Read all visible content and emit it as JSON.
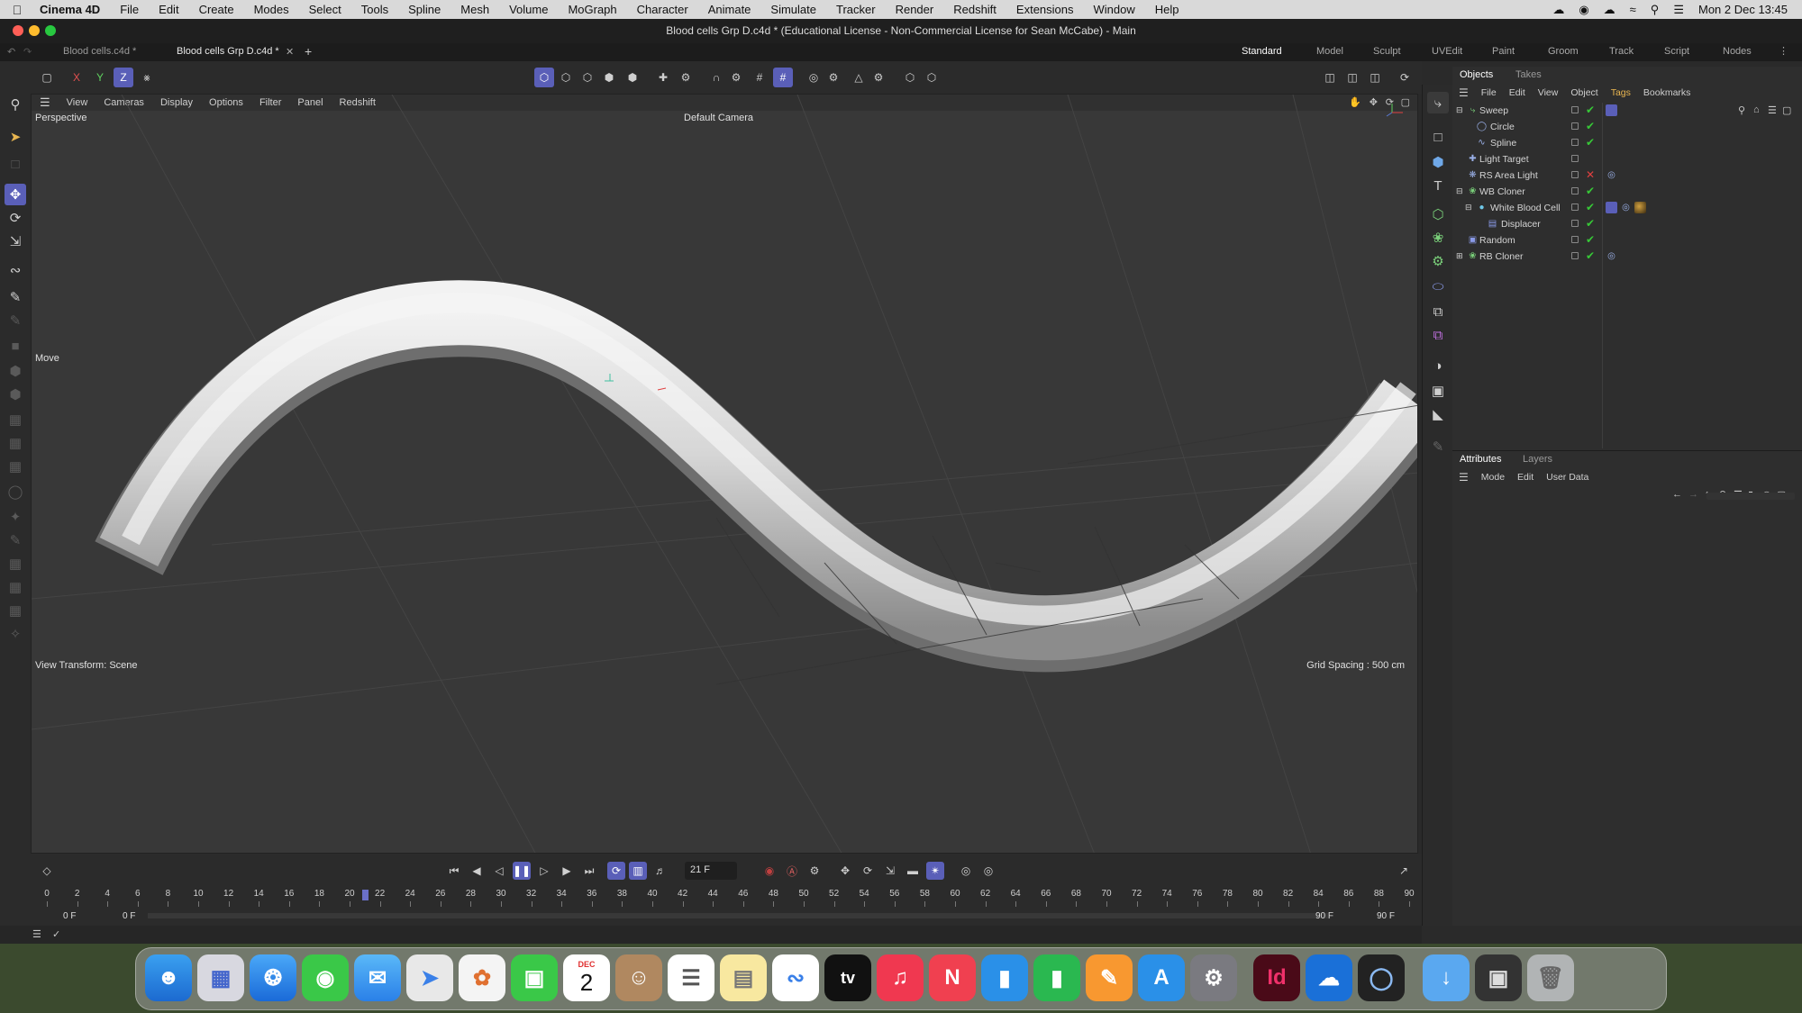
{
  "menubar": {
    "app_name": "Cinema 4D",
    "items": [
      "File",
      "Edit",
      "Create",
      "Modes",
      "Select",
      "Tools",
      "Spline",
      "Mesh",
      "Volume",
      "MoGraph",
      "Character",
      "Animate",
      "Simulate",
      "Tracker",
      "Render",
      "Redshift",
      "Extensions",
      "Window",
      "Help"
    ],
    "clock": "Mon 2 Dec  13:45"
  },
  "window": {
    "title": "Blood cells Grp D.c4d * (Educational License - Non-Commercial License for Sean McCabe) - Main",
    "doc_tabs": [
      "Blood cells.c4d *",
      "Blood cells Grp D.c4d *"
    ],
    "active_tab": "Blood cells Grp D.c4d *",
    "layouts": [
      "Standard",
      "Model",
      "Sculpt",
      "UVEdit",
      "Paint",
      "Groom",
      "Track",
      "Script",
      "Nodes"
    ],
    "active_layout": "Standard"
  },
  "toolbar": {
    "axis_x": "X",
    "axis_y": "Y",
    "axis_z": "Z"
  },
  "viewport": {
    "menu": [
      "View",
      "Cameras",
      "Display",
      "Options",
      "Filter",
      "Panel",
      "Redshift"
    ],
    "projection": "Perspective",
    "camera": "Default Camera",
    "tool_label": "Move",
    "view_transform": "View Transform: Scene",
    "grid_spacing": "Grid Spacing : 500 cm"
  },
  "objects": {
    "tabs": [
      "Objects",
      "Takes"
    ],
    "menu": [
      "File",
      "Edit",
      "View",
      "Object",
      "Tags",
      "Bookmarks"
    ],
    "active_menu": "Tags",
    "rows": [
      {
        "name": "Sweep",
        "level": 0,
        "expander": "-",
        "icon": "sweep-icon",
        "status": "check"
      },
      {
        "name": "Circle",
        "level": 1,
        "expander": "",
        "icon": "circle-icon",
        "status": "check"
      },
      {
        "name": "Spline",
        "level": 1,
        "expander": "",
        "icon": "spline-icon",
        "status": "check"
      },
      {
        "name": "Light Target",
        "level": 0,
        "expander": "",
        "icon": "light-target-icon",
        "status": ""
      },
      {
        "name": "RS Area Light",
        "level": 0,
        "expander": "",
        "icon": "light-icon",
        "status": "x"
      },
      {
        "name": "WB Cloner",
        "level": 0,
        "expander": "-",
        "icon": "cloner-icon",
        "status": "check"
      },
      {
        "name": "White Blood Cell",
        "level": 1,
        "expander": "-",
        "icon": "sphere-icon",
        "status": "check"
      },
      {
        "name": "Displacer",
        "level": 2,
        "expander": "",
        "icon": "displacer-icon",
        "status": "check"
      },
      {
        "name": "Random",
        "level": 0,
        "expander": "",
        "icon": "random-icon",
        "status": "check"
      },
      {
        "name": "RB Cloner",
        "level": 0,
        "expander": "+",
        "icon": "cloner-icon",
        "status": "check"
      }
    ]
  },
  "attributes": {
    "tabs": [
      "Attributes",
      "Layers"
    ],
    "menu": [
      "Mode",
      "Edit",
      "User Data"
    ]
  },
  "timeline": {
    "current_frame": "21 F",
    "current_frame_value": 21,
    "start_frame": "0 F",
    "preview_start": "0 F",
    "end_frame": "90 F",
    "preview_end": "90 F",
    "ticks": [
      "0",
      "2",
      "4",
      "6",
      "8",
      "10",
      "12",
      "14",
      "16",
      "18",
      "20",
      "22",
      "24",
      "26",
      "28",
      "30",
      "32",
      "34",
      "36",
      "38",
      "40",
      "42",
      "44",
      "46",
      "48",
      "50",
      "52",
      "54",
      "56",
      "58",
      "60",
      "62",
      "64",
      "66",
      "68",
      "70",
      "72",
      "74",
      "76",
      "78",
      "80",
      "82",
      "84",
      "86",
      "88",
      "90"
    ]
  },
  "dock": {
    "calendar_month": "DEC",
    "calendar_day": "2",
    "tv_label": "tv",
    "indesign_label": "Id"
  }
}
